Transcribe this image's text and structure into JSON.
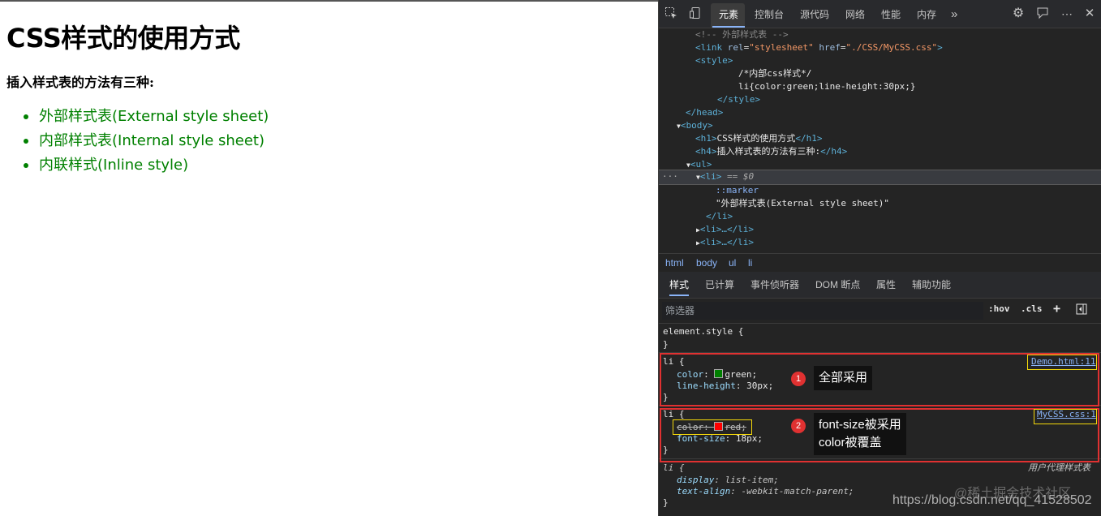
{
  "page": {
    "heading": "CSS样式的使用方式",
    "subheading": "插入样式表的方法有三种:",
    "items": [
      "外部样式表(External style sheet)",
      "内部样式表(Internal style sheet)",
      "内联样式(Inline style)"
    ],
    "item_color": "#008000"
  },
  "devtools": {
    "toolbar": {
      "tabs": [
        "元素",
        "控制台",
        "源代码",
        "网络",
        "性能",
        "内存"
      ],
      "active_tab": "元素",
      "more": "»"
    },
    "elements": {
      "comment": "<!-- 外部样式表 -->",
      "link_tag": "link",
      "link_rel_attr": "rel",
      "link_rel_val": "\"stylesheet\"",
      "link_href_attr": "href",
      "link_href_val": "\"./CSS/MyCSS.css\"",
      "style_open": "<style>",
      "style_comment": "/*内部css样式*/",
      "style_rule": "li{color:green;line-height:30px;}",
      "style_close": "</style>",
      "head_close": "</head>",
      "body_open": "<body>",
      "h1_open": "<h1>",
      "h1_text": "CSS样式的使用方式",
      "h1_close": "</h1>",
      "h4_open": "<h4>",
      "h4_text": "插入样式表的方法有三种:",
      "h4_close": "</h4>",
      "ul_open": "<ul>",
      "li_selected": "<li>",
      "li_eq": " == $0",
      "dots": "···",
      "marker": "::marker",
      "li_text": "\"外部样式表(External style sheet)\"",
      "li_close": "</li>",
      "li_collapsed_1": "<li>…</li>",
      "li_collapsed_2": "<li>…</li>"
    },
    "breadcrumbs": [
      "html",
      "body",
      "ul",
      "li"
    ],
    "subtabs": [
      "样式",
      "已计算",
      "事件侦听器",
      "DOM 断点",
      "属性",
      "辅助功能"
    ],
    "filter": {
      "placeholder": "筛选器",
      "hov": ":hov",
      "cls": ".cls",
      "plus": "+"
    },
    "styles": {
      "element_style": "element.style {",
      "close_brace": "}",
      "rule1": {
        "selector": "li {",
        "source": "Demo.html:11",
        "color_prop": "color",
        "color_val": "green;",
        "color_swatch": "#008000",
        "lh_prop": "line-height",
        "lh_val": "30px;"
      },
      "rule2": {
        "selector": "li {",
        "source": "MyCSS.css:1",
        "color_prop": "color",
        "color_val": "red;",
        "color_swatch": "#ff0000",
        "fs_prop": "font-size",
        "fs_val": "18px;"
      },
      "rule3": {
        "selector": "li {",
        "source": "用户代理样式表",
        "display_prop": "display",
        "display_val": "list-item;",
        "ta_prop": "text-align",
        "ta_val": "-webkit-match-parent;"
      }
    }
  },
  "annotations": {
    "badge1": "1",
    "callout1": "全部采用",
    "badge2": "2",
    "callout2_line1": "font-size被采用",
    "callout2_line2": "color被覆盖"
  },
  "watermark": {
    "url": "https://blog.csdn.net/qq_41528502",
    "site": "@稀土掘金技术社区"
  }
}
